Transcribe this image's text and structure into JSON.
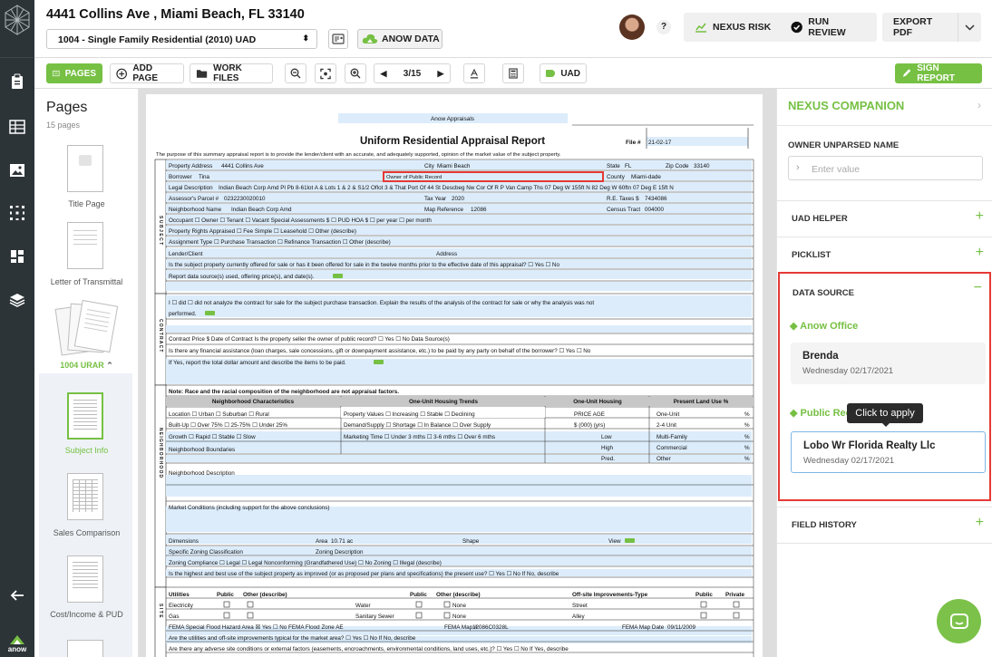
{
  "header": {
    "address": "4441 Collins Ave , Miami Beach, FL 33140",
    "form_select": "1004 - Single Family Residential (2010) UAD",
    "anow_data": "ANOW DATA",
    "help": "?",
    "nexus_risk": "NEXUS RISK",
    "run_review": "RUN REVIEW",
    "export_pdf": "EXPORT PDF"
  },
  "toolbar": {
    "pages": "PAGES",
    "add_page": "ADD PAGE",
    "work_files": "WORK FILES",
    "page_indicator": "3/15",
    "uad": "UAD",
    "sign_report": "SIGN REPORT"
  },
  "pages_panel": {
    "title": "Pages",
    "count": "15 pages",
    "items": [
      {
        "label": "Title Page"
      },
      {
        "label": "Letter of Transmittal"
      },
      {
        "label": "1004 URAR"
      },
      {
        "label": "Subject Info"
      },
      {
        "label": "Sales Comparison"
      },
      {
        "label": "Cost/Income & PUD"
      }
    ]
  },
  "document": {
    "company": "Anow Appraisals",
    "title": "Uniform Residential Appraisal Report",
    "file_label": "File #",
    "file_no": "21-02-17",
    "purpose": "The purpose of this summary appraisal report is to provide the lender/client with an accurate, and adequately supported, opinion of the market value of the subject property.",
    "subject": {
      "property_address_label": "Property Address",
      "property_address": "4441 Collins Ave",
      "city_label": "City",
      "city": "Miami Beach",
      "state_label": "State",
      "state": "FL",
      "zip_label": "Zip Code",
      "zip": "33140",
      "borrower_label": "Borrower",
      "borrower": "Tina",
      "owner_label": "Owner of Public Record",
      "county_label": "County",
      "county": "Miami-dade",
      "legal_label": "Legal Description",
      "legal": "Indian Beach Corp Amd Pl Pb 8-61lot A & Lots 1 & 2 & S1/2 Oflot 3 & That Port Of 44 St Descbeg Nw Cor Of R P Van Camp Ths 07 Deg W 155ft N 82 Deg W 60ftn 07 Deg E 15ft N",
      "parcel_label": "Assessor's Parcel #",
      "parcel": "0232230020010",
      "taxyear_label": "Tax Year",
      "taxyear": "2020",
      "retaxes_label": "R.E. Taxes $",
      "retaxes": "7434086",
      "neighborhood_label": "Neighborhood Name",
      "neighborhood": "Indian Beach Corp Amd",
      "mapref_label": "Map Reference",
      "mapref": "12086",
      "census_label": "Census Tract",
      "census": "004000",
      "occupant_row": "Occupant  ☐ Owner   ☐ Tenant   ☐ Vacant          Special Assessments $                          ☐ PUD    HOA $                    ☐ per year  ☐ per month",
      "rights_row": "Property Rights Appraised  ☐ Fee Simple  ☐ Leasehold  ☐ Other (describe)",
      "assign_row": "Assignment Type  ☐ Purchase Transaction  ☐ Refinance Transaction  ☐ Other (describe)",
      "lender_label": "Lender/Client",
      "lender_addr_label": "Address",
      "offered_row": "Is the subject property currently offered for sale or has it been offered for sale in the twelve months prior to the effective date of this appraisal?  ☐ Yes  ☐ No",
      "report_row": "Report data source(s) used, offering price(s), and date(s)."
    },
    "contract": {
      "row1": "I  ☐ did  ☐ did not analyze the contract for sale for the subject purchase transaction. Explain the results of the analysis of the contract for sale or why the analysis was not",
      "row1b": "performed.",
      "row2": "Contract Price $                 Date of Contract                 Is the property seller the owner of public record?   ☐ Yes  ☐ No   Data Source(s)",
      "row3": "Is there any financial assistance (loan charges, sale concessions, gift or downpayment assistance, etc.) to be paid by any party on behalf of the borrower?  ☐ Yes  ☐ No",
      "row4": "If Yes, report the total dollar amount and describe the items to be paid."
    },
    "neighborhood": {
      "note": "Note: Race and the racial composition of the neighborhood are not appraisal factors.",
      "h1": "Neighborhood Characteristics",
      "h2": "One-Unit Housing Trends",
      "h3": "One-Unit Housing",
      "h4": "Present Land Use %",
      "r1": "Location  ☐ Urban         ☐ Suburban      ☐ Rural",
      "r2": "Built-Up  ☐ Over 75%     ☐ 25-75%        ☐ Under 25%",
      "r3": "Growth    ☐ Rapid         ☐ Stable          ☐ Slow",
      "t1": "Property Values  ☐ Increasing   ☐ Stable       ☐ Declining",
      "t2": "Demand/Supply   ☐ Shortage     ☐ In Balance  ☐ Over Supply",
      "t3": "Marketing Time  ☐ Under 3 mths ☐ 3-6 mths   ☐ Over 6 mths",
      "oh1": "PRICE      AGE",
      "oh2": "$ (000)     (yrs)",
      "oh3": "Low",
      "oh4": "High",
      "oh5": "Pred.",
      "lu1": "One-Unit",
      "lu2": "2-4 Unit",
      "lu3": "Multi-Family",
      "lu4": "Commercial",
      "lu5": "Other",
      "pct": "%",
      "boundaries": "Neighborhood Boundaries",
      "description": "Neighborhood Description",
      "market": "Market Conditions (including support for the above conclusions)"
    },
    "site": {
      "dimensions": "Dimensions",
      "area_label": "Area",
      "area": "10.71 ac",
      "shape": "Shape",
      "view": "View",
      "zoning_class": "Specific Zoning Classification",
      "zoning_desc": "Zoning Description",
      "zoning_compliance": "Zoning Compliance  ☐ Legal  ☐ Legal Nonconforming (Grandfathered Use)  ☐ No Zoning  ☐ Illegal (describe)",
      "hbu": "Is the highest and best use of the subject property as improved (or as proposed per plans and specifications) the present use?  ☐ Yes  ☐ No   If No, describe",
      "utilities": "Utilities",
      "public": "Public",
      "other_describe": "Other (describe)",
      "offsite": "Off-site Improvements-Type",
      "private": "Private",
      "electricity": "Electricity",
      "gas": "Gas",
      "water": "Water",
      "sewer": "Sanitary Sewer",
      "none": "None",
      "street": "Street",
      "alley": "Alley",
      "fema_row": "FEMA Special Flood Hazard Area  ☒ Yes  ☐ No  FEMA Flood Zone  AE",
      "fema_map_label": "FEMA Map #",
      "fema_map": "12086C0328L",
      "fema_date_label": "FEMA Map Date",
      "fema_date": "09/11/2009",
      "util_row": "Are the utilities and off-site improvements typical for the market area?  ☐ Yes  ☐ No   If No, describe",
      "adverse_row": "Are there any adverse site conditions or external factors (easements, encroachments, environmental conditions, land uses, etc.)?  ☐ Yes  ☐ No   If Yes, describe"
    },
    "side_labels": {
      "subject": "SUBJECT",
      "contract": "CONTRACT",
      "neighborhood": "NEIGHBORHOOD",
      "site": "SITE"
    }
  },
  "companion": {
    "title": "NEXUS COMPANION",
    "owner_label": "OWNER UNPARSED NAME",
    "owner_placeholder": "Enter value",
    "uad_helper": "UAD HELPER",
    "picklist": "PICKLIST",
    "data_source": "DATA SOURCE",
    "anow_office": "Anow Office",
    "src1_name": "Brenda",
    "src1_date": "Wednesday 02/17/2021",
    "public_records": "Public Records",
    "tooltip": "Click to apply",
    "src2_name": "Lobo Wr Florida Realty Llc",
    "src2_date": "Wednesday 02/17/2021",
    "field_history": "FIELD HISTORY"
  },
  "colors": {
    "accent": "#76c043",
    "rail": "#2d3438",
    "highlight": "#e53935",
    "field": "#dcecfb"
  }
}
